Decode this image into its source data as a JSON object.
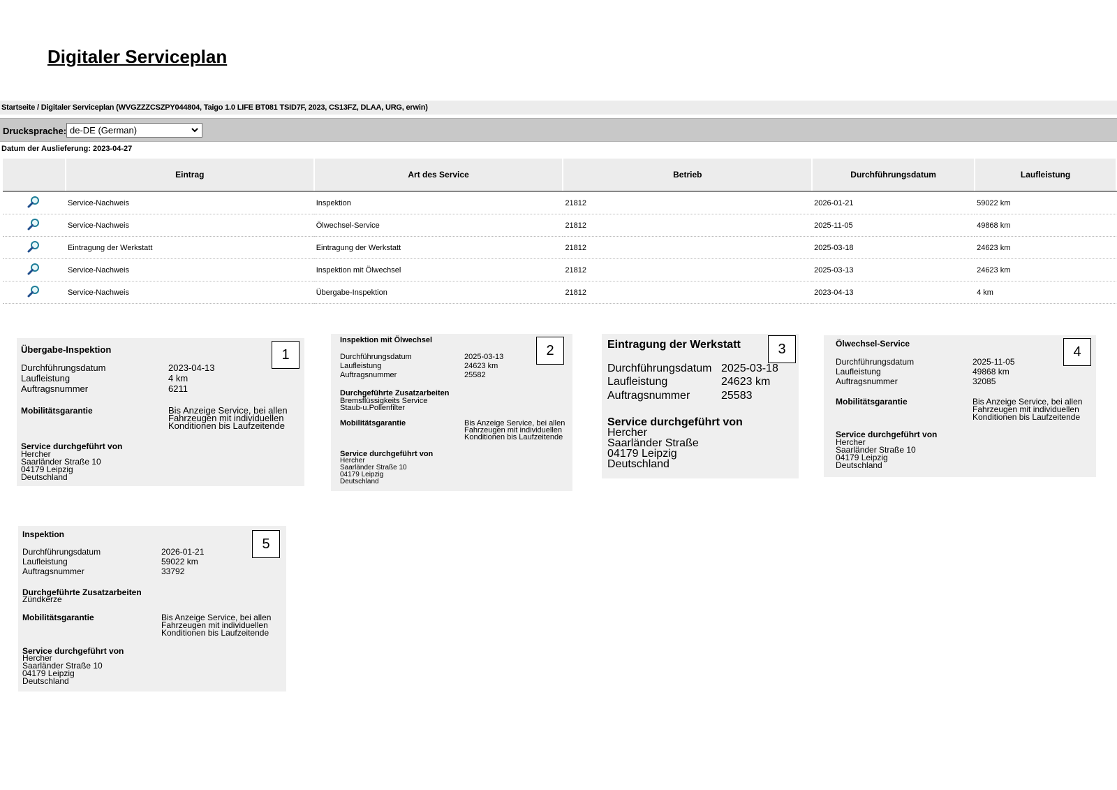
{
  "page": {
    "title": "Digitaler Serviceplan"
  },
  "breadcrumb": "Startseite / Digitaler Serviceplan (WVGZZZCSZPY044804, Taigo 1.0 LIFE BT081 TSID7F, 2023, CS13FZ, DLAA, URG, erwin)",
  "print_language": {
    "label": "Drucksprache:",
    "value": "de-DE (German)"
  },
  "delivery_date": "Datum der Auslieferung: 2023-04-27",
  "table": {
    "headers": [
      "",
      "Eintrag",
      "Art des Service",
      "Betrieb",
      "Durchführungsdatum",
      "Laufleistung"
    ],
    "rows": [
      {
        "entry": "Service-Nachweis",
        "service": "Inspektion",
        "workshop": "21812",
        "date": "2026-01-21",
        "mileage": "59022 km"
      },
      {
        "entry": "Service-Nachweis",
        "service": "Ölwechsel-Service",
        "workshop": "21812",
        "date": "2025-11-05",
        "mileage": "49868 km"
      },
      {
        "entry": "Eintragung der Werkstatt",
        "service": "Eintragung der Werkstatt",
        "workshop": "21812",
        "date": "2025-03-18",
        "mileage": "24623 km"
      },
      {
        "entry": "Service-Nachweis",
        "service": "Inspektion mit Ölwechsel",
        "workshop": "21812",
        "date": "2025-03-13",
        "mileage": "24623 km"
      },
      {
        "entry": "Service-Nachweis",
        "service": "Übergabe-Inspektion",
        "workshop": "21812",
        "date": "2023-04-13",
        "mileage": "4 km"
      }
    ]
  },
  "labels": {
    "date": "Durchführungsdatum",
    "mileage": "Laufleistung",
    "order": "Auftragsnummer",
    "extra_work": "Durchgeführte Zusatzarbeiten",
    "mobility": "Mobilitätsgarantie",
    "performed_by": "Service durchgeführt von"
  },
  "mobility_text": [
    "Bis Anzeige Service, bei allen",
    "Fahrzeugen mit individuellen",
    "Konditionen bis Laufzeitende"
  ],
  "address": [
    "Hercher",
    "Saarländer Straße 10",
    "04179 Leipzig",
    "Deutschland"
  ],
  "address_card3": [
    "Hercher",
    "Saarländer Straße",
    "04179 Leipzig",
    "Deutschland"
  ],
  "cards": [
    {
      "number": "1",
      "title": "Übergabe-Inspektion",
      "date": "2023-04-13",
      "mileage": "4 km",
      "order": "6211"
    },
    {
      "number": "2",
      "title": "Inspektion mit Ölwechsel",
      "date": "2025-03-13",
      "mileage": "24623 km",
      "order": "25582",
      "extra_work": [
        "Bremsflüssigkeits Service",
        "Staub-u.Pollenfilter"
      ]
    },
    {
      "number": "3",
      "title": "Eintragung der Werkstatt",
      "date": "2025-03-18",
      "mileage": "24623 km",
      "order": "25583"
    },
    {
      "number": "4",
      "title": "Ölwechsel-Service",
      "date": "2025-11-05",
      "mileage": "49868 km",
      "order": "32085"
    },
    {
      "number": "5",
      "title": "Inspektion",
      "date": "2026-01-21",
      "mileage": "59022 km",
      "order": "33792",
      "extra_work": [
        "Zündkerze"
      ]
    }
  ],
  "icons": {
    "row_action": "magnifier-icon",
    "select_chevron": "chevron-down-icon"
  }
}
